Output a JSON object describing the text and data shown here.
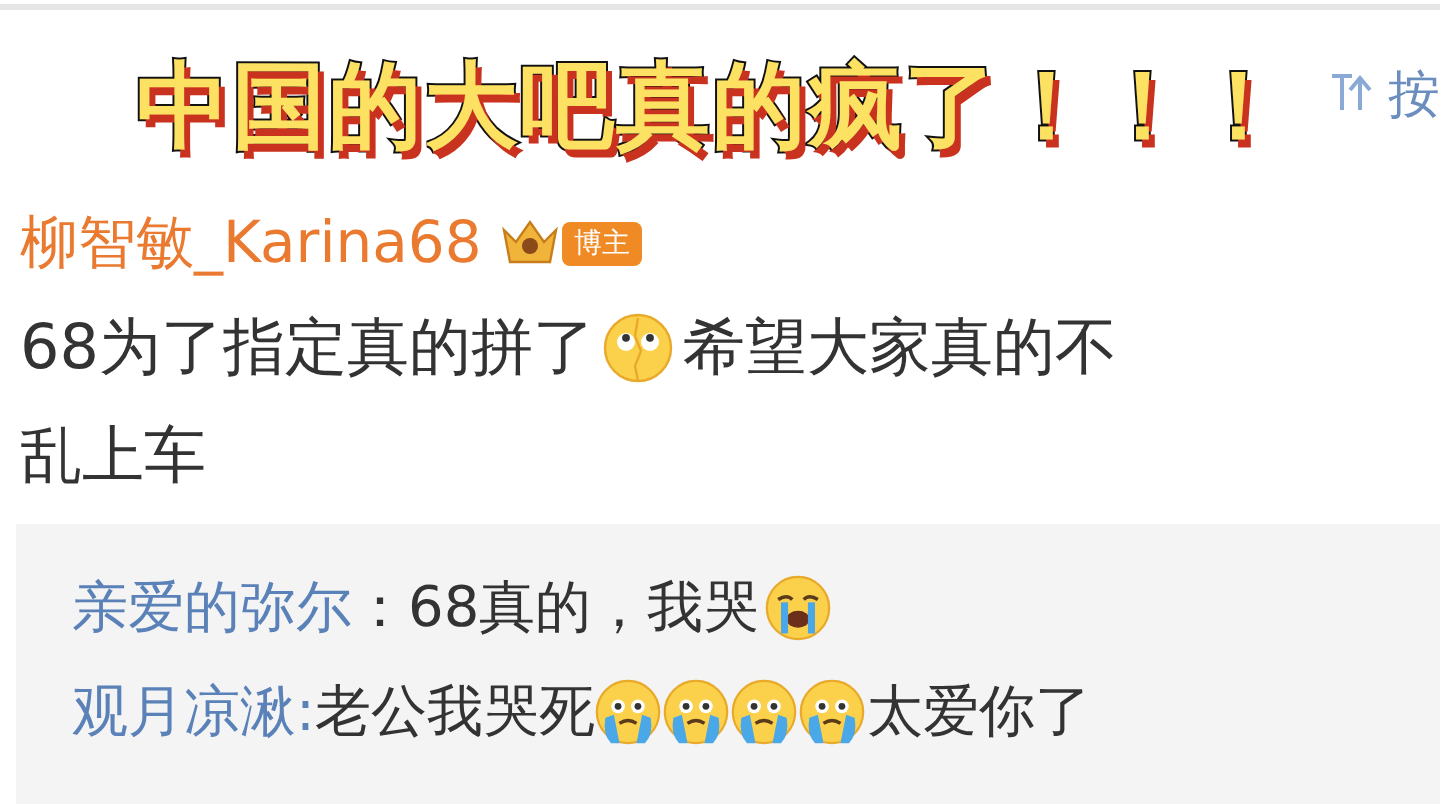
{
  "overlay_title": "中国的大吧真的疯了！！！",
  "sort": {
    "label": "按"
  },
  "post": {
    "author": "柳智敏_Karina68",
    "badge": "博主",
    "lines": [
      [
        {
          "kind": "text",
          "text": "68为了指定真的拼了"
        },
        {
          "kind": "eyes-up-emoji"
        },
        {
          "kind": "text",
          "text": "希望大家真的不"
        }
      ],
      [
        {
          "kind": "text",
          "text": "乱上车"
        }
      ]
    ]
  },
  "replies": [
    {
      "author": "亲爱的弥尔",
      "segments": [
        {
          "kind": "text",
          "text": "：68真的，我哭"
        },
        {
          "kind": "crying-emoji"
        }
      ]
    },
    {
      "author": "观月凉湫:",
      "segments": [
        {
          "kind": "text",
          "text": "老公我哭死"
        },
        {
          "kind": "teary-emoji"
        },
        {
          "kind": "teary-emoji"
        },
        {
          "kind": "teary-emoji"
        },
        {
          "kind": "teary-emoji"
        },
        {
          "kind": "text",
          "text": "太爱你了"
        }
      ]
    }
  ]
}
